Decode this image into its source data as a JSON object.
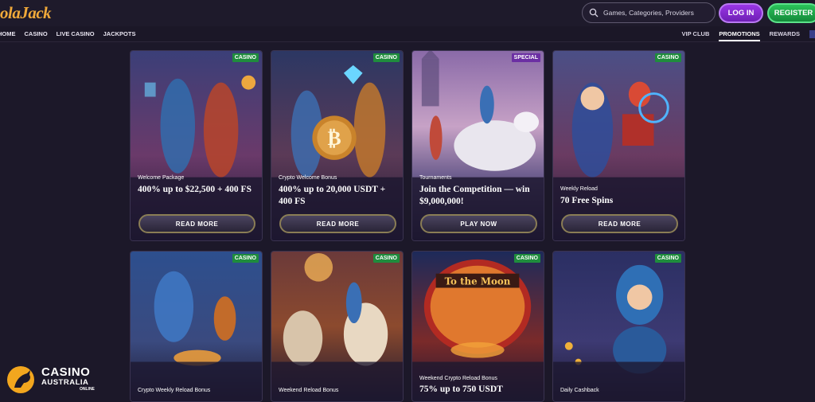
{
  "header": {
    "logo_text": "olaJack",
    "search_placeholder": "Games, Categories, Providers",
    "login_label": "LOG IN",
    "register_label": "REGISTER"
  },
  "nav": {
    "left": [
      "HOME",
      "CASINO",
      "LIVE CASINO",
      "JACKPOTS"
    ],
    "right": [
      "VIP CLUB",
      "PROMOTIONS",
      "REWARDS"
    ],
    "active": "PROMOTIONS"
  },
  "cards": [
    {
      "badge": "CASINO",
      "subtitle": "Welcome Package",
      "title": "400% up to $22,500 + 400 FS",
      "button": "READ MORE"
    },
    {
      "badge": "CASINO",
      "subtitle": "Crypto Welcome Bonus",
      "title": "400% up to 20,000 USDT + 400 FS",
      "button": "READ MORE"
    },
    {
      "badge": "SPECIAL",
      "subtitle": "Tournaments",
      "title": "Join the Competition — win $9,000,000!",
      "button": "PLAY NOW"
    },
    {
      "badge": "CASINO",
      "subtitle": "Weekly Reload",
      "title": "70 Free Spins",
      "button": "READ MORE"
    },
    {
      "badge": "CASINO",
      "subtitle": "Crypto Weekly Reload Bonus",
      "title": "",
      "button": ""
    },
    {
      "badge": "CASINO",
      "subtitle": "Weekend Reload Bonus",
      "title": "",
      "button": ""
    },
    {
      "badge": "CASINO",
      "subtitle": "Weekend Crypto Reload Bonus",
      "title": "75% up to 750 USDT",
      "button": "",
      "art_text": "To the Moon"
    },
    {
      "badge": "CASINO",
      "subtitle": "Daily Cashback",
      "title": "",
      "button": ""
    }
  ],
  "watermark": {
    "line1": "CASINO",
    "line2": "AUSTRALIA",
    "line3": "ONLINE"
  },
  "colors": {
    "background": "#1c1829",
    "login": "#8a2be2",
    "register": "#1fa84a",
    "casino_badge": "#1f8c3d",
    "special_badge": "#6b2fa3"
  }
}
